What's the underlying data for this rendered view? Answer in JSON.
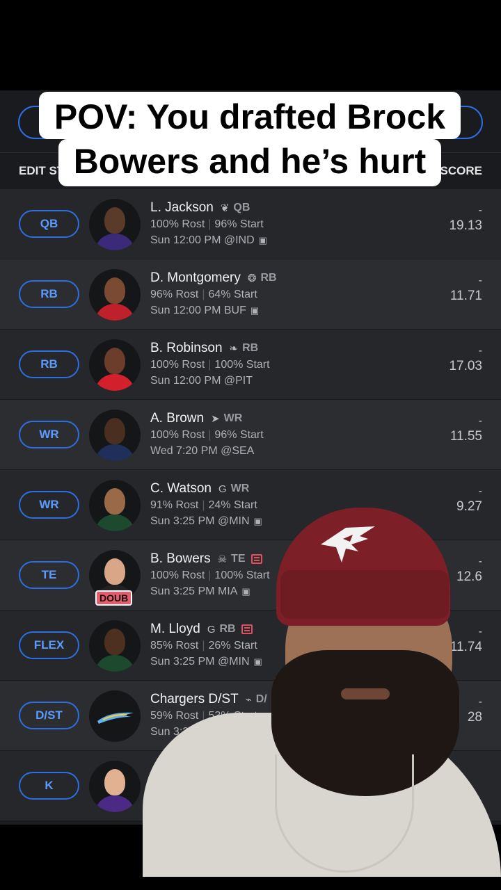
{
  "caption": {
    "line1": "POV: You drafted Brock",
    "line2": "Bowers and he’s hurt"
  },
  "header": {
    "edit_label": "EDIT ST",
    "score_label": "SCORE"
  },
  "roster": [
    {
      "slot": "QB",
      "name": "L. Jackson",
      "team_icon": "ravens-logo-icon",
      "position": "QB",
      "rost": "100% Rost",
      "start": "96% Start",
      "game": "Sun 12:00 PM @IND",
      "tv": true,
      "news": false,
      "badge": "",
      "proj_dash": "-",
      "score": "19.13",
      "jersey": "#3b2a7a",
      "skin": "#5a3a28"
    },
    {
      "slot": "RB",
      "name": "D. Montgomery",
      "team_icon": "texans-logo-icon",
      "position": "RB",
      "rost": "96% Rost",
      "start": "64% Start",
      "game": "Sun 12:00 PM BUF",
      "tv": true,
      "news": false,
      "badge": "",
      "proj_dash": "-",
      "score": "11.71",
      "jersey": "#c0202c",
      "skin": "#7a4a32"
    },
    {
      "slot": "RB",
      "name": "B. Robinson",
      "team_icon": "falcons-logo-icon",
      "position": "RB",
      "rost": "100% Rost",
      "start": "100% Start",
      "game": "Sun 12:00 PM @PIT",
      "tv": false,
      "news": false,
      "badge": "",
      "proj_dash": "-",
      "score": "17.03",
      "jersey": "#d3202d",
      "skin": "#6b3d2a"
    },
    {
      "slot": "WR",
      "name": "A. Brown",
      "team_icon": "patriots-logo-icon",
      "position": "WR",
      "rost": "100% Rost",
      "start": "96% Start",
      "game": "Wed 7:20 PM @SEA",
      "tv": false,
      "news": false,
      "badge": "",
      "proj_dash": "-",
      "score": "11.55",
      "jersey": "#1f2f5a",
      "skin": "#4a2e20"
    },
    {
      "slot": "WR",
      "name": "C. Watson",
      "team_icon": "packers-logo-icon",
      "position": "WR",
      "rost": "91% Rost",
      "start": "24% Start",
      "game": "Sun 3:25 PM @MIN",
      "tv": true,
      "news": false,
      "badge": "",
      "proj_dash": "-",
      "score": "9.27",
      "jersey": "#1d4a2e",
      "skin": "#9a6a48"
    },
    {
      "slot": "TE",
      "name": "B. Bowers",
      "team_icon": "raiders-logo-icon",
      "position": "TE",
      "rost": "100% Rost",
      "start": "100% Start",
      "game": "Sun 3:25 PM MIA",
      "tv": true,
      "news": true,
      "badge": "DOUB",
      "proj_dash": "-",
      "score": "12.6",
      "jersey": "#222222",
      "skin": "#d9a787"
    },
    {
      "slot": "FLEX",
      "name": "M. Lloyd",
      "team_icon": "packers-logo-icon",
      "position": "RB",
      "rost": "85% Rost",
      "start": "26% Start",
      "game": "Sun 3:25 PM @MIN",
      "tv": true,
      "news": true,
      "badge": "",
      "proj_dash": "-",
      "score": "11.74",
      "jersey": "#1d4a2e",
      "skin": "#4e3020"
    },
    {
      "slot": "D/ST",
      "name": "Chargers D/ST",
      "team_icon": "chargers-logo-icon",
      "position": "D/",
      "rost": "59% Rost",
      "start": "53% Start",
      "game": "Sun 3:25 PM ARI",
      "tv": false,
      "news": false,
      "badge": "",
      "proj_dash": "-",
      "score": "28",
      "jersey": "",
      "skin": ""
    },
    {
      "slot": "K",
      "name": "",
      "team_icon": "",
      "position": "",
      "rost": "",
      "start": "",
      "game": "",
      "tv": false,
      "news": false,
      "badge": "",
      "proj_dash": "",
      "score": "",
      "jersey": "#4b2a86",
      "skin": "#e1b192"
    }
  ],
  "colors": {
    "accent": "#2d6fe0",
    "slot_text": "#5b9bff",
    "row_bg": "#26272b",
    "row_bg_alt": "#2c2d31",
    "news": "#e05060",
    "doubtful_badge": "#e85b6a"
  }
}
